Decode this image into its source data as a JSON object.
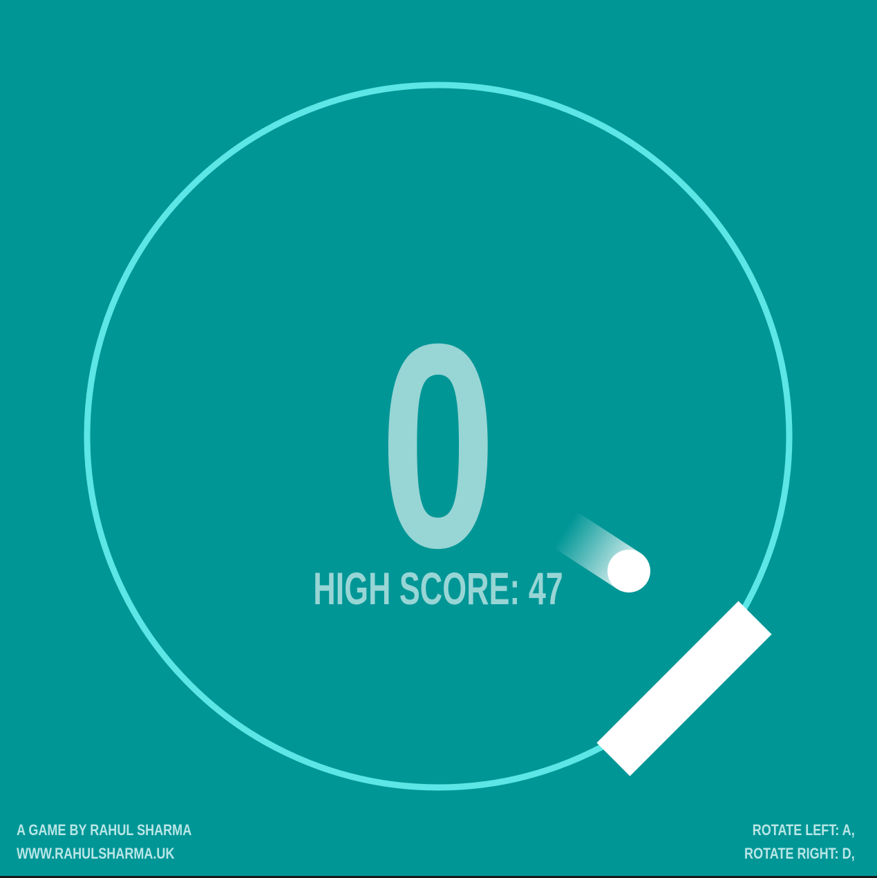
{
  "game": {
    "score": "0",
    "high_score_label": "HIGH SCORE: 47"
  },
  "credits": {
    "author": "A GAME BY RAHUL SHARMA",
    "website": "WWW.RAHULSHARMA.UK"
  },
  "controls": {
    "rotate_left": "ROTATE LEFT: A,",
    "rotate_right": "ROTATE RIGHT: D,"
  },
  "colors": {
    "background": "#009696",
    "ring": "#5ce6e6",
    "score_text": "#98d5d5",
    "ball": "#ffffff",
    "paddle": "#ffffff",
    "credit_text": "#b9e6e6"
  }
}
